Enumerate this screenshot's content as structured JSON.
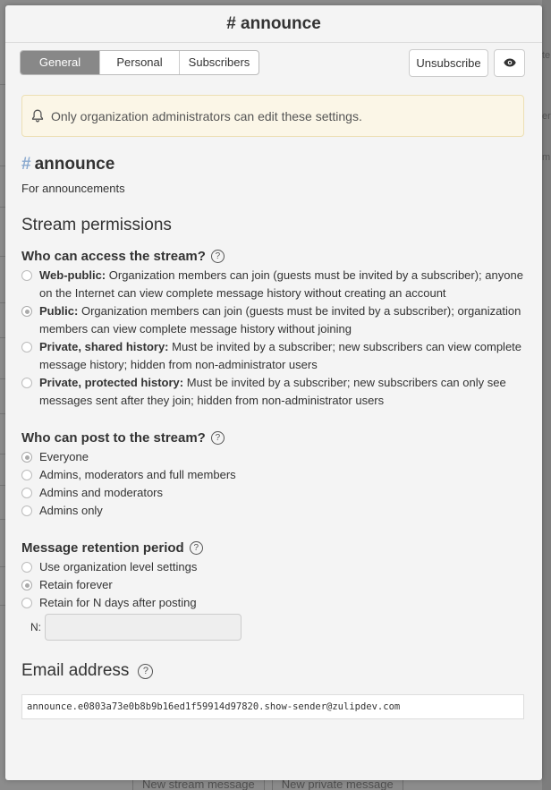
{
  "header": {
    "title": "# announce"
  },
  "tabs": [
    {
      "label": "General",
      "active": true
    },
    {
      "label": "Personal",
      "active": false
    },
    {
      "label": "Subscribers",
      "active": false
    }
  ],
  "toolbar": {
    "unsubscribe_label": "Unsubscribe",
    "view_icon": "eye-icon"
  },
  "banner": {
    "icon": "bell-icon",
    "text": "Only organization administrators can edit these settings."
  },
  "stream": {
    "hash": "#",
    "name": "announce",
    "description": "For announcements"
  },
  "permissions": {
    "section_title": "Stream permissions",
    "access": {
      "title": "Who can access the stream?",
      "options": [
        {
          "label": "Web-public:",
          "desc": "Organization members can join (guests must be invited by a subscriber); anyone on the Internet can view complete message history without creating an account",
          "checked": false
        },
        {
          "label": "Public:",
          "desc": "Organization members can join (guests must be invited by a subscriber); organization members can view complete message history without joining",
          "checked": true
        },
        {
          "label": "Private, shared history:",
          "desc": "Must be invited by a subscriber; new subscribers can view complete message history; hidden from non-administrator users",
          "checked": false
        },
        {
          "label": "Private, protected history:",
          "desc": "Must be invited by a subscriber; new subscribers can only see messages sent after they join; hidden from non-administrator users",
          "checked": false
        }
      ]
    },
    "post": {
      "title": "Who can post to the stream?",
      "options": [
        {
          "label": "Everyone",
          "checked": true
        },
        {
          "label": "Admins, moderators and full members",
          "checked": false
        },
        {
          "label": "Admins and moderators",
          "checked": false
        },
        {
          "label": "Admins only",
          "checked": false
        }
      ]
    },
    "retention": {
      "title": "Message retention period",
      "options": [
        {
          "label": "Use organization level settings",
          "checked": false
        },
        {
          "label": "Retain forever",
          "checked": true
        },
        {
          "label": "Retain for N days after posting",
          "checked": false
        }
      ],
      "n_label": "N:",
      "n_value": ""
    }
  },
  "email": {
    "title": "Email address",
    "address": "announce.e0803a73e0b8b9b16ed1f59914d97820.show-sender@zulipdev.com"
  },
  "background": {
    "new_stream_message": "New stream message",
    "new_private_message": "New private message",
    "edge_fragments": [
      "te",
      "er",
      "m"
    ]
  }
}
